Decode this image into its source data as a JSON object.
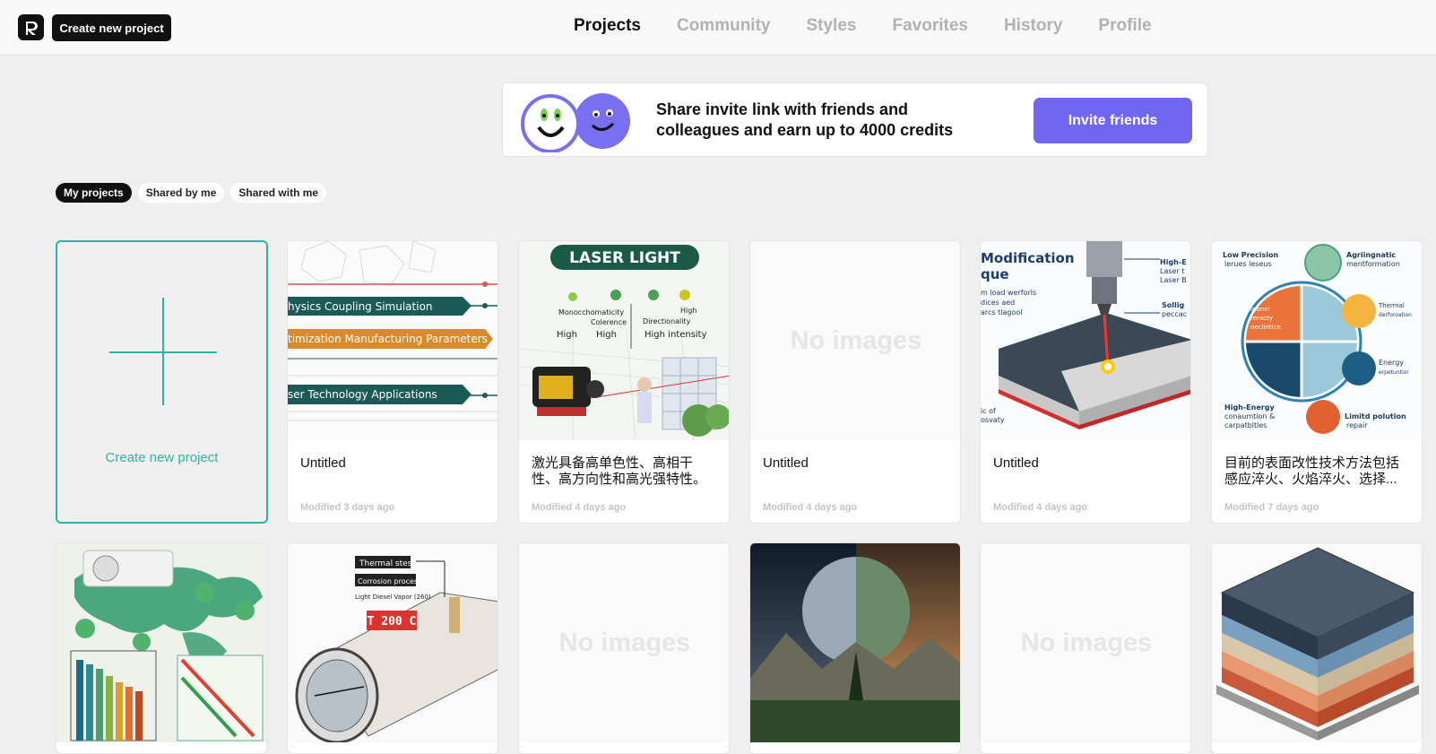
{
  "header": {
    "create_label": "Create new project",
    "nav": [
      {
        "label": "Projects",
        "active": true
      },
      {
        "label": "Community",
        "active": false
      },
      {
        "label": "Styles",
        "active": false
      },
      {
        "label": "Favorites",
        "active": false
      },
      {
        "label": "History",
        "active": false
      },
      {
        "label": "Profile",
        "active": false
      }
    ]
  },
  "banner": {
    "line1": "Share invite link with friends and",
    "line2": "colleagues and earn up to 4000 credits",
    "button_label": "Invite friends"
  },
  "filters": [
    {
      "label": "My projects",
      "active": true
    },
    {
      "label": "Shared by me",
      "active": false
    },
    {
      "label": "Shared with me",
      "active": false
    }
  ],
  "new_project_label": "Create new project",
  "projects": [
    {
      "title": "Untitled",
      "modified": "Modified 3 days ago",
      "thumb_texts": [
        "hysics Coupling Simulation",
        "timization Manufacturing Parameters",
        "ser Technology Applications"
      ]
    },
    {
      "title": "激光具备高单色性、高相干性、高方向性和高光强特性。",
      "modified": "Modified 4 days ago",
      "thumb_texts": [
        "LASER LIGHT",
        "Monocchomaticity",
        "Colerence",
        "High",
        "Directionality",
        "High",
        "High",
        "High intensity"
      ]
    },
    {
      "title": "Untitled",
      "modified": "Modified 4 days ago",
      "no_images": "No images"
    },
    {
      "title": "Untitled",
      "modified": "Modified 4 days ago",
      "thumb_texts": [
        "Modification",
        "que",
        "m load werforls",
        "dices aed",
        "arcs tlagool",
        "High-E",
        "Laser t",
        "Laser B",
        "Sollig",
        "peccac",
        "ic of",
        "osvaty"
      ]
    },
    {
      "title": "目前的表面改性技术方法包括感应淬火、火焰淬火、选择...",
      "modified": "Modified 7 days ago",
      "thumb_texts": [
        "Low Precision",
        "lerues leseus",
        "Agriingnatic",
        "mentformation",
        "Inonel",
        "reracty",
        "neciintice",
        "Thermal",
        "derforoation",
        "Energy",
        "erpetuntior",
        "High-Energy",
        "conaumtion &",
        "carpatbltles",
        "Limitd polution",
        "repair"
      ]
    },
    {
      "title": "",
      "modified": "",
      "thumb_texts": []
    },
    {
      "title": "",
      "modified": "",
      "thumb_texts": [
        "Thermal stess",
        "Corrosion process",
        "Light Diesel Vapor (260)",
        "T 200 C"
      ]
    },
    {
      "title": "",
      "modified": "",
      "no_images": "No images"
    },
    {
      "title": "",
      "modified": "",
      "thumb_texts": []
    },
    {
      "title": "",
      "modified": "",
      "no_images": "No images"
    },
    {
      "title": "",
      "modified": "",
      "thumb_texts": []
    }
  ],
  "colors": {
    "accent": "#2db3a4",
    "invite": "#7066f2",
    "dark": "#111111"
  }
}
